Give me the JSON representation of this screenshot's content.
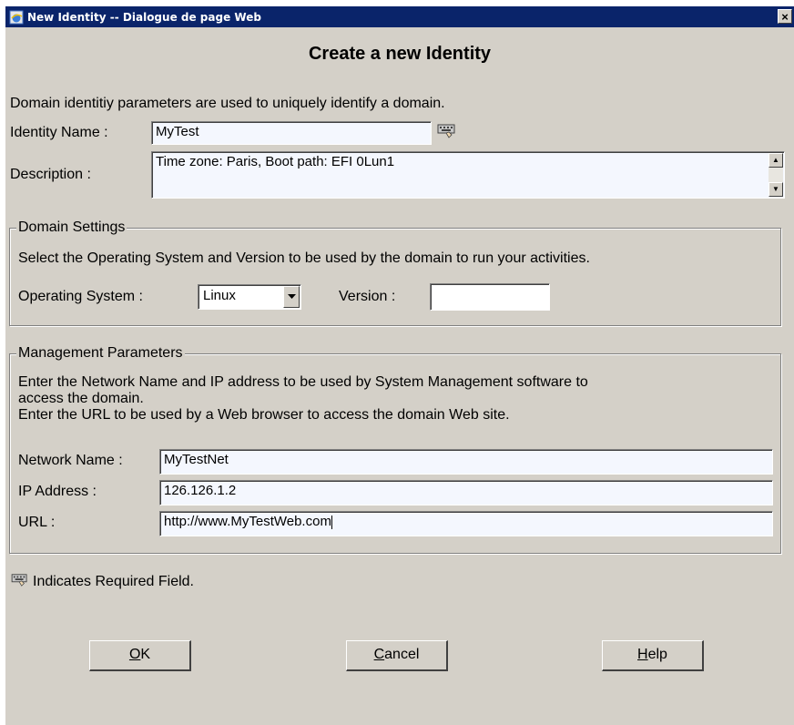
{
  "window": {
    "title": "New Identity -- Dialogue de page Web",
    "close_glyph": "×"
  },
  "heading": "Create a new Identity",
  "intro": "Domain identitiy parameters are used to uniquely identify a domain.",
  "identity": {
    "name_label": "Identity Name :",
    "name_value": "MyTest",
    "description_label": "Description :",
    "description_value": "Time zone: Paris, Boot path: EFI 0Lun1"
  },
  "domain_settings": {
    "legend": "Domain Settings",
    "hint": "Select the Operating System and Version to be used by the domain to run your activities.",
    "os_label": "Operating System :",
    "os_value": "Linux",
    "version_label": "Version :",
    "version_value": ""
  },
  "management": {
    "legend": "Management Parameters",
    "hint_line1": "Enter the Network Name and IP address to be used by System Management software to",
    "hint_line2": "access the domain.",
    "hint_line3": "Enter the URL to be used by a Web browser to access the domain Web site.",
    "network_label": "Network Name :",
    "network_value": "MyTestNet",
    "ip_label": "IP Address :",
    "ip_value": "126.126.1.2",
    "url_label": "URL :",
    "url_value": "http://www.MyTestWeb.com"
  },
  "required_note": "Indicates Required Field.",
  "buttons": {
    "ok_mnemonic": "O",
    "ok_rest": "K",
    "cancel_mnemonic": "C",
    "cancel_rest": "ancel",
    "help_mnemonic": "H",
    "help_rest": "elp"
  },
  "icons": {
    "title": "ie-page-icon",
    "required": "keyboard-hand-icon",
    "dropdown": "chevron-down-icon"
  }
}
